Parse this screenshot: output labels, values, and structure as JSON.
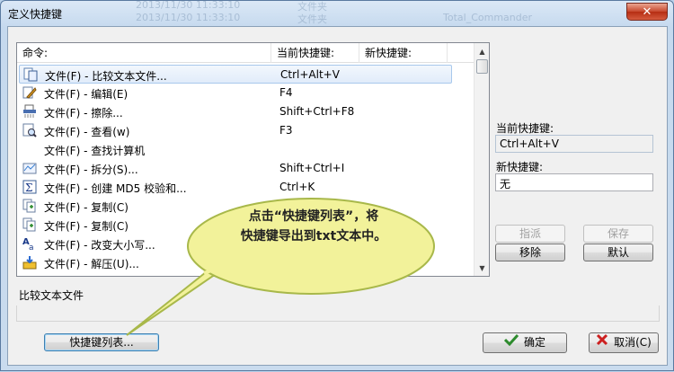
{
  "window": {
    "title": "定义快捷键",
    "close_label": "✕"
  },
  "background_ghost": {
    "date1": "2013/11/30 11:33:10",
    "date2": "2013/11/30 11:33:10",
    "type1": "文件夹",
    "type2": "文件夹",
    "folder": "Total_Commander"
  },
  "list": {
    "headers": {
      "command": "命令:",
      "current": "当前快捷键:",
      "new": "新快捷键:"
    },
    "rows": [
      {
        "icon": "compare-files-icon",
        "command": "文件(F) - 比较文本文件...",
        "key": "Ctrl+Alt+V",
        "selected": true
      },
      {
        "icon": "edit-icon",
        "command": "文件(F) - 编辑(E)",
        "key": "F4"
      },
      {
        "icon": "shredder-icon",
        "command": "文件(F) - 擦除...",
        "key": "Shift+Ctrl+F8"
      },
      {
        "icon": "view-icon",
        "command": "文件(F) - 查看(w)",
        "key": "F3"
      },
      {
        "icon": "",
        "command": "文件(F) - 查找计算机",
        "key": ""
      },
      {
        "icon": "split-file-icon",
        "command": "文件(F) - 拆分(S)...",
        "key": "Shift+Ctrl+I"
      },
      {
        "icon": "checksum-icon",
        "command": "文件(F) - 创建 MD5 校验和...",
        "key": "Ctrl+K"
      },
      {
        "icon": "copy-icon",
        "command": "文件(F) - 复制(C)",
        "key": "Shift+F5"
      },
      {
        "icon": "copy-icon",
        "command": "文件(F) - 复制(C)",
        "key": ""
      },
      {
        "icon": "change-case-icon",
        "command": "文件(F) - 改变大小写...",
        "key": ""
      },
      {
        "icon": "unpack-icon",
        "command": "文件(F) - 解压(U)...",
        "key": ""
      }
    ]
  },
  "description": "比较文本文件",
  "right_panel": {
    "current_label": "当前快捷键:",
    "current_value": "Ctrl+Alt+V",
    "new_label": "新快捷键:",
    "new_value": "无",
    "assign": "指派",
    "save": "保存",
    "remove": "移除",
    "default": "默认"
  },
  "buttons": {
    "list": "快捷键列表...",
    "ok": "确定",
    "cancel": "取消(C)"
  },
  "callout": {
    "line1": "点击“快捷键列表”，将",
    "line2": "快捷键导出到txt文本中。"
  },
  "colors": {
    "callout_fill": "#f2f29a",
    "callout_stroke": "#a8b84a",
    "ok_check": "#2e8b2e",
    "cancel_x": "#cc2020"
  }
}
